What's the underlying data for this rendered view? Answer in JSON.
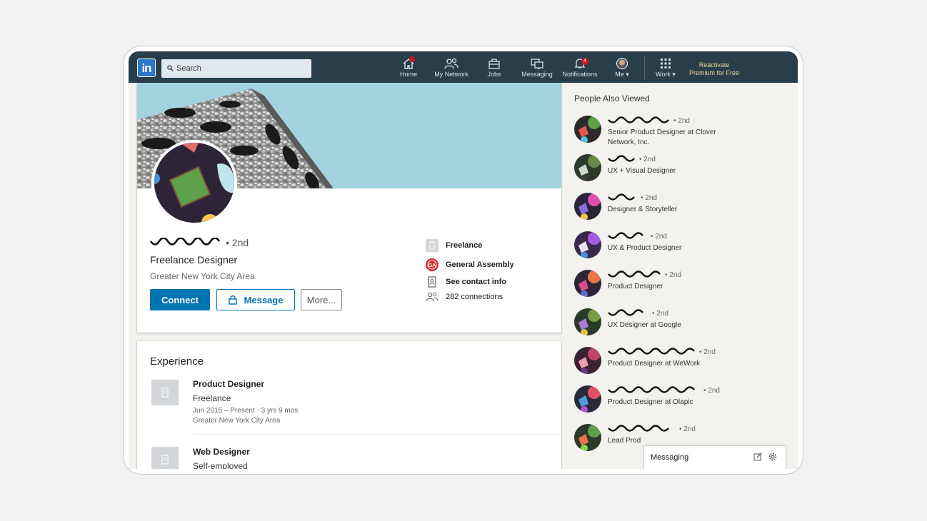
{
  "nav": {
    "search_placeholder": "Search",
    "items": [
      {
        "label": "Home",
        "icon": "home-icon",
        "badge": ""
      },
      {
        "label": "My Network",
        "icon": "network-icon",
        "badge": ""
      },
      {
        "label": "Jobs",
        "icon": "briefcase-icon",
        "badge": ""
      },
      {
        "label": "Messaging",
        "icon": "messaging-icon",
        "badge": ""
      },
      {
        "label": "Notifications",
        "icon": "bell-icon",
        "badge": "4"
      },
      {
        "label": "Me",
        "icon": "avatar-icon",
        "badge": ""
      },
      {
        "label": "Work",
        "icon": "grid-icon",
        "badge": ""
      }
    ],
    "premium_line1": "Reactivate",
    "premium_line2": "Premium for Free",
    "brand_color": "#283e4a",
    "logo_text": "in"
  },
  "profile": {
    "degree": "• 2nd",
    "headline": "Freelance Designer",
    "location": "Greater New York City Area",
    "connect_label": "Connect",
    "message_label": "Message",
    "more_label": "More...",
    "side": {
      "company": "Freelance",
      "school": "General Assembly",
      "contact": "See contact info",
      "connections": "282 connections"
    }
  },
  "experience": {
    "title": "Experience",
    "items": [
      {
        "role": "Product Designer",
        "company": "Freelance",
        "dates": "Jun 2015 – Present · 3 yrs 9 mos",
        "location": "Greater New York City Area"
      },
      {
        "role": "Web Designer",
        "company": "Self-employed"
      }
    ]
  },
  "rail": {
    "title": "People Also Viewed",
    "people": [
      {
        "degree": "• 2nd",
        "headline": "Senior Product Designer at Clover Network, Inc."
      },
      {
        "degree": "• 2nd",
        "headline": "UX + Visual Designer"
      },
      {
        "degree": "• 2nd",
        "headline": "Designer & Storyteller"
      },
      {
        "degree": "• 2nd",
        "headline": "UX & Product Designer"
      },
      {
        "degree": "• 2nd",
        "headline": "Product Designer"
      },
      {
        "degree": "• 2nd",
        "headline": "UX Designer at Google"
      },
      {
        "degree": "• 2nd",
        "headline": "Product Designer at WeWork"
      },
      {
        "degree": "• 2nd",
        "headline": "Product Designer at Olapic"
      },
      {
        "degree": "• 2nd",
        "headline": "Lead Prod"
      }
    ]
  },
  "messaging": {
    "label": "Messaging"
  }
}
